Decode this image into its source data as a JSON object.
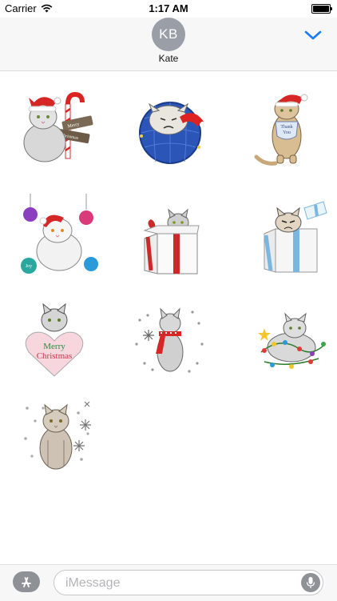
{
  "status_bar": {
    "carrier": "Carrier",
    "time": "1:17 AM",
    "battery_level": 1.0
  },
  "header": {
    "avatar_initials": "KB",
    "contact_name": "Kate",
    "collapse_icon": "chevron-down-icon"
  },
  "stickers": [
    {
      "name": "cat-candy-cane-merry-christmas",
      "lines": [
        "Merry",
        "Christmas"
      ]
    },
    {
      "name": "grumpy-cat-santa-ornament",
      "lines": []
    },
    {
      "name": "cat-santa-hat-thank-you",
      "lines": [
        "Thank",
        "You"
      ]
    },
    {
      "name": "cat-santa-hat-ornaments",
      "lines": [
        "Joy"
      ]
    },
    {
      "name": "cat-in-gift-box-red-bow",
      "lines": []
    },
    {
      "name": "grumpy-cat-gift-box-blue",
      "lines": []
    },
    {
      "name": "cat-heart-merry-christmas",
      "lines": [
        "Merry",
        "Christmas"
      ]
    },
    {
      "name": "cat-red-scarf-snowflakes",
      "lines": []
    },
    {
      "name": "cat-christmas-lights",
      "lines": []
    },
    {
      "name": "fluffy-cat-snowflakes",
      "lines": []
    }
  ],
  "compose": {
    "placeholder": "iMessage",
    "apps_icon": "app-store-icon",
    "mic_icon": "microphone-icon"
  },
  "colors": {
    "accent": "#1a7cf5",
    "avatar": "#9a9ea6",
    "bar_bg": "#f7f7f7"
  }
}
